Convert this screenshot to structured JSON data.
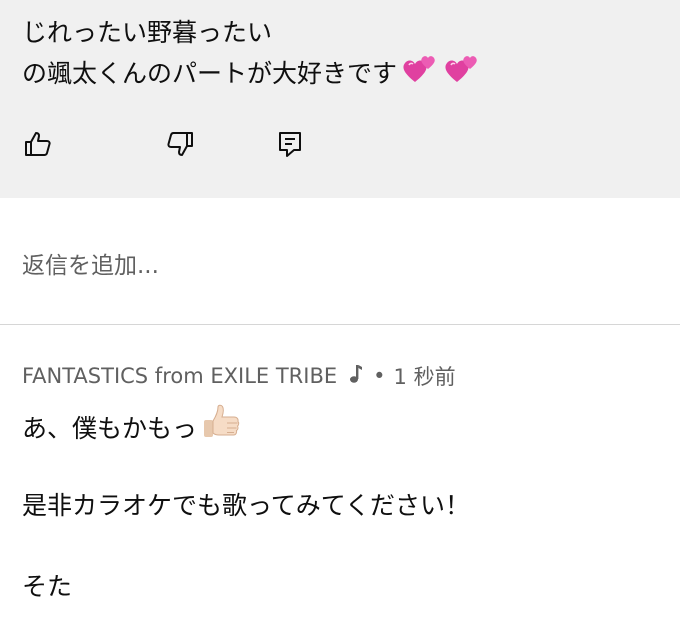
{
  "comment": {
    "line1": "じれったい野暮ったい",
    "line2": "の颯太くんのパートが大好きです",
    "emojis": [
      "two-hearts-emoji",
      "two-hearts-emoji"
    ],
    "emoji_color": "#e040a0"
  },
  "actions": {
    "like_icon": "thumbs-up-icon",
    "dislike_icon": "thumbs-down-icon",
    "reply_icon": "comment-reply-icon"
  },
  "reply_box": {
    "placeholder": "返信を追加..."
  },
  "reply": {
    "author": "FANTASTICS from EXILE TRIBE",
    "author_badge_icon": "music-note-icon",
    "separator": "•",
    "time": "1 秒前",
    "lines": [
      "あ、僕もかもっ",
      "是非カラオケでも歌ってみてください！",
      "そた"
    ],
    "inline_emoji": "thumbs-up-emoji"
  },
  "colors": {
    "comment_bg": "#f0f0f0",
    "text_primary": "#0f0f0f",
    "text_secondary": "#606060",
    "divider": "#d6d6d6"
  }
}
